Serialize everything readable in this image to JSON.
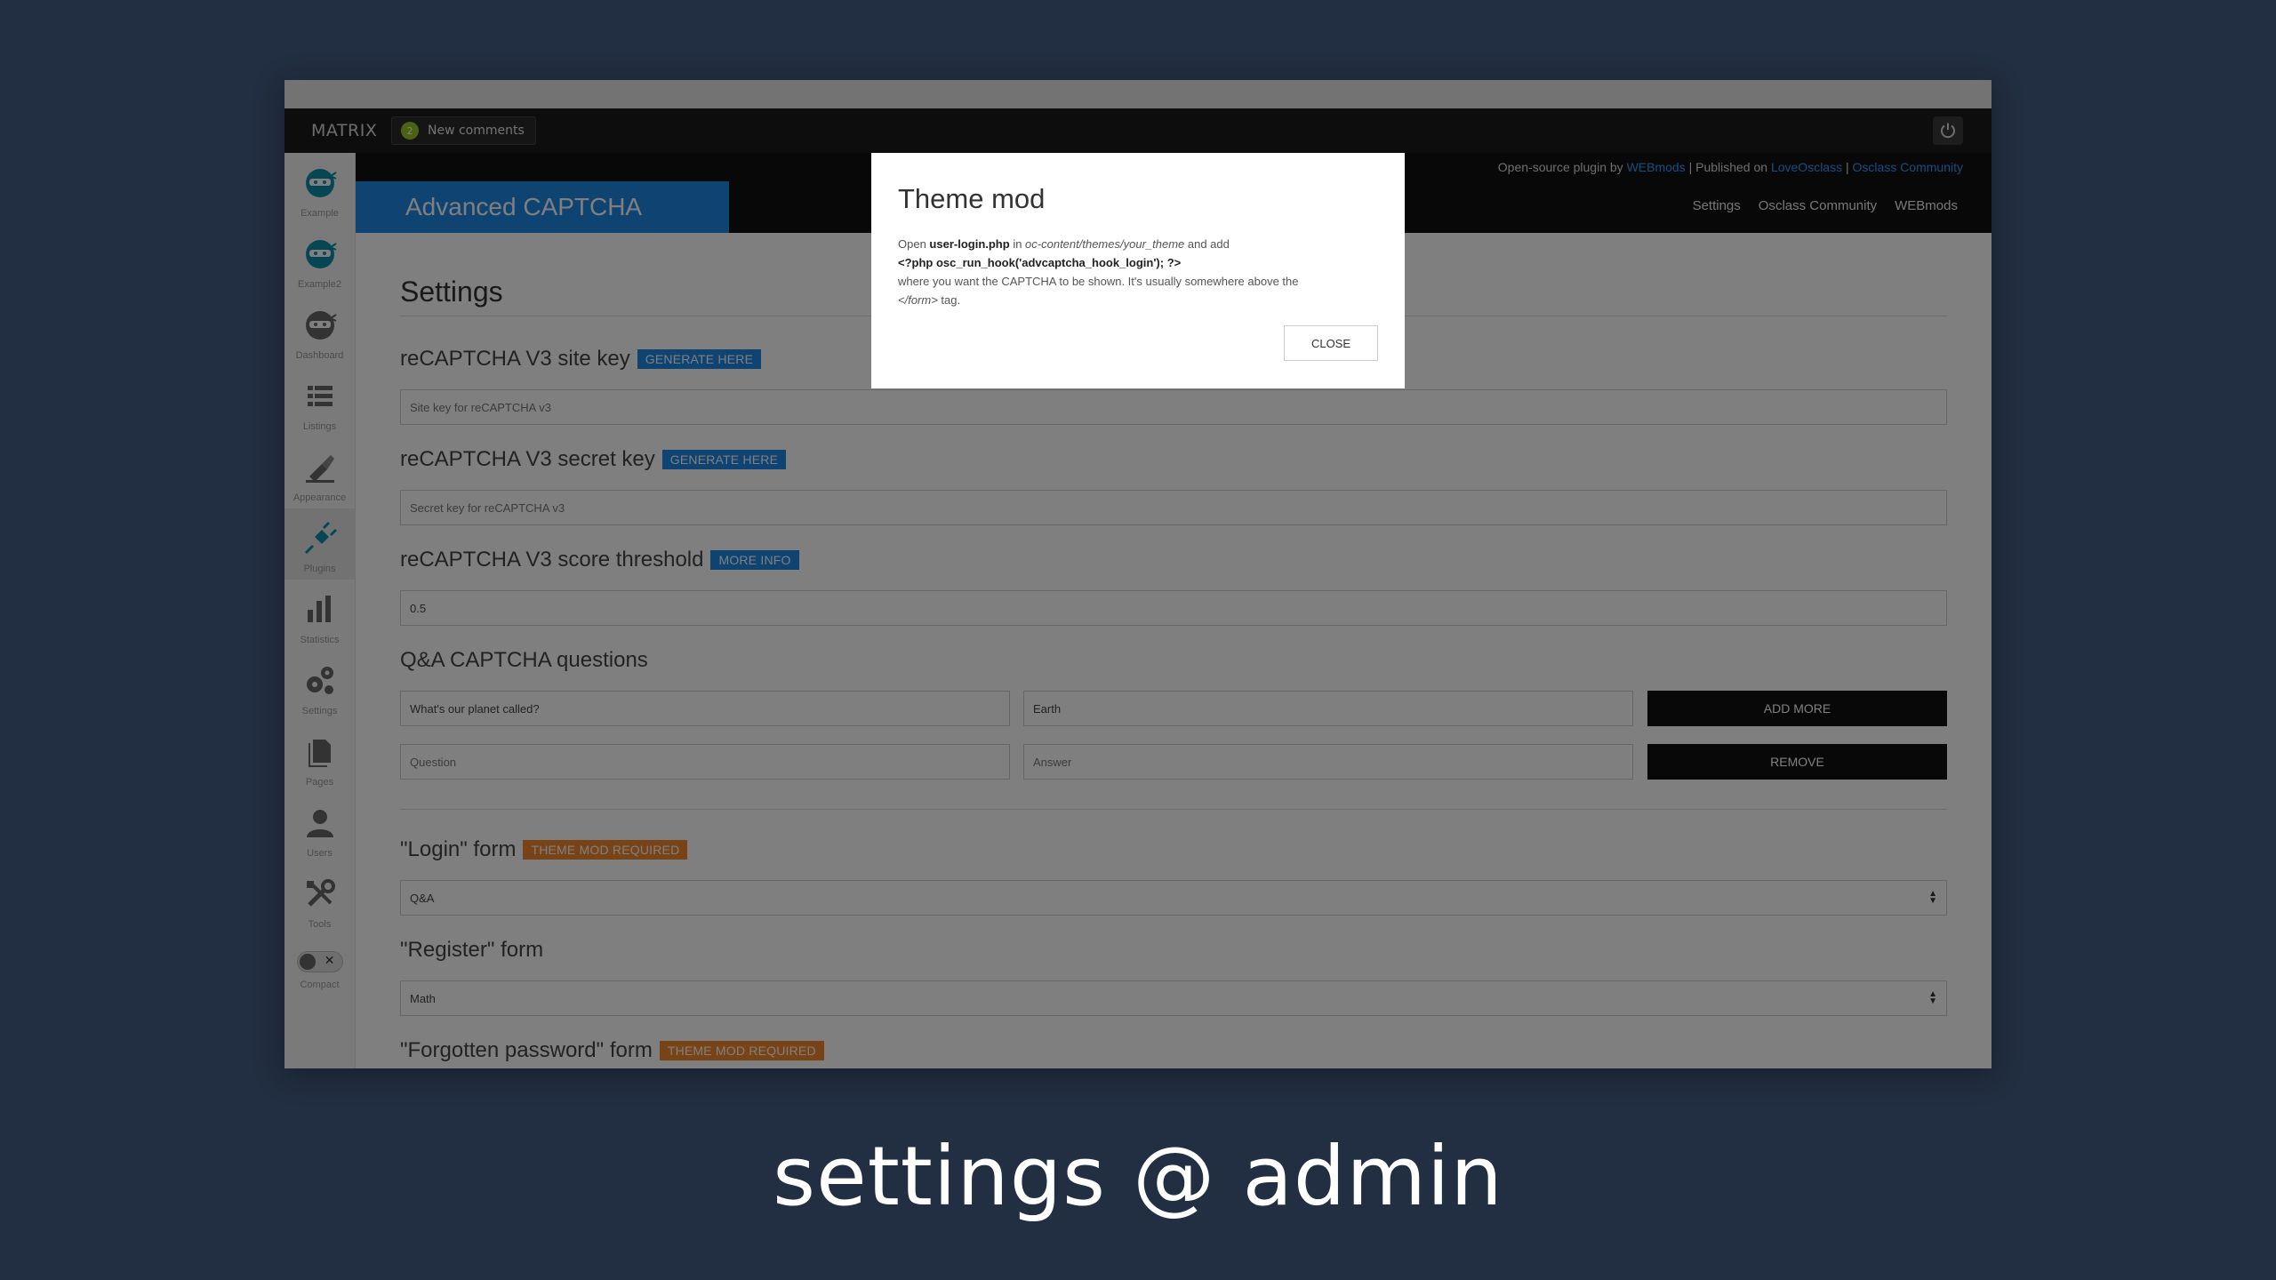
{
  "topbar": {
    "brand": "MATRIX",
    "notif_count": "2",
    "notif_label": "New comments"
  },
  "infobar": {
    "prefix": "Open-source plugin by ",
    "link1": "WEBmods",
    "sep1": " | Published on ",
    "link2": "LoveOsclass",
    "sep2": " | ",
    "link3": "Osclass Community"
  },
  "header": {
    "title": "Advanced CAPTCHA",
    "tabs": [
      "Settings",
      "Osclass Community",
      "WEBmods"
    ]
  },
  "sidebar": {
    "items": [
      {
        "label": "Example",
        "icon": "ninja-icon"
      },
      {
        "label": "Example2",
        "icon": "ninja-icon"
      },
      {
        "label": "Dashboard",
        "icon": "ninja-icon"
      },
      {
        "label": "Listings",
        "icon": "list-icon"
      },
      {
        "label": "Appearance",
        "icon": "brush-icon"
      },
      {
        "label": "Plugins",
        "icon": "plug-icon"
      },
      {
        "label": "Statistics",
        "icon": "bar-chart-icon"
      },
      {
        "label": "Settings",
        "icon": "gears-icon"
      },
      {
        "label": "Pages",
        "icon": "pages-icon"
      },
      {
        "label": "Users",
        "icon": "user-icon"
      },
      {
        "label": "Tools",
        "icon": "tools-icon"
      }
    ],
    "compact_label": "Compact"
  },
  "content": {
    "heading": "Settings",
    "site_key": {
      "label": "reCAPTCHA V3 site key",
      "badge": "GENERATE HERE",
      "placeholder": "Site key for reCAPTCHA v3"
    },
    "secret_key": {
      "label": "reCAPTCHA V3 secret key",
      "badge": "GENERATE HERE",
      "placeholder": "Secret key for reCAPTCHA v3"
    },
    "threshold": {
      "label": "reCAPTCHA V3 score threshold",
      "badge": "MORE INFO",
      "value": "0.5"
    },
    "qa": {
      "label": "Q&A CAPTCHA questions",
      "row1": {
        "question": "What's our planet called?",
        "answer": "Earth",
        "button": "ADD MORE"
      },
      "row2": {
        "question_placeholder": "Question",
        "answer_placeholder": "Answer",
        "button": "REMOVE"
      }
    },
    "login_form": {
      "label": "\"Login\" form",
      "badge": "THEME MOD REQUIRED",
      "value": "Q&A"
    },
    "register_form": {
      "label": "\"Register\" form",
      "value": "Math"
    },
    "forgot_form": {
      "label": "\"Forgotten password\" form",
      "badge": "THEME MOD REQUIRED"
    }
  },
  "modal": {
    "title": "Theme mod",
    "line1_a": "Open ",
    "line1_file": "user-login.php",
    "line1_b": " in ",
    "line1_path": "oc-content/themes/your_theme",
    "line1_c": " and add",
    "line2_code": "<?php osc_run_hook('advcaptcha_hook_login'); ?>",
    "line3": "where you want the CAPTCHA to be shown. It's usually somewhere above the",
    "line4_tag": "</form>",
    "line4_rest": " tag.",
    "close": "CLOSE"
  },
  "caption": "settings @ admin",
  "colors": {
    "background": "#222e41",
    "accent_blue": "#1e88e5",
    "badge_orange": "#f0892f",
    "notif_green": "#9bc32b"
  }
}
